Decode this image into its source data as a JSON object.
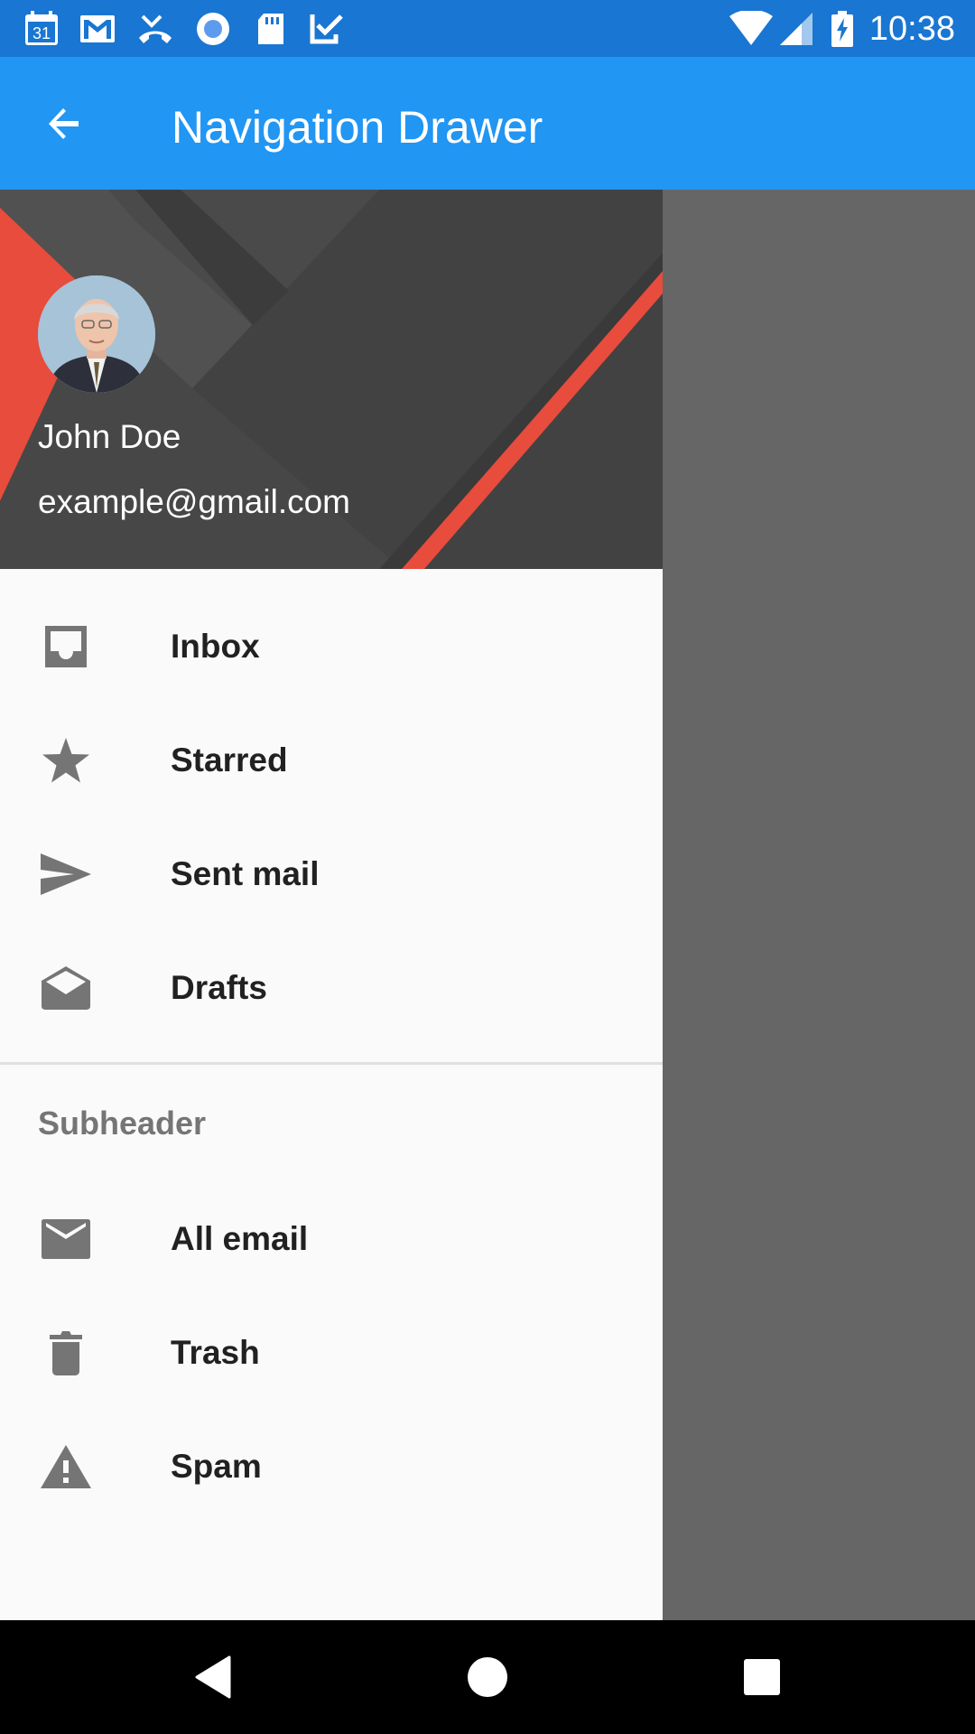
{
  "status_bar": {
    "time": "10:38",
    "calendar_day": "31",
    "icons": [
      "calendar-icon",
      "gmail-icon",
      "missed-call-icon",
      "record-icon",
      "sd-card-icon",
      "check-icon",
      "wifi-icon",
      "signal-icon",
      "battery-charging-icon"
    ],
    "color": "#1976d2"
  },
  "app_bar": {
    "title": "Navigation Drawer",
    "back_icon": "arrow-back-icon",
    "color": "#2196f3"
  },
  "drawer": {
    "header": {
      "name": "John Doe",
      "email": "example@gmail.com",
      "accent": "#e74c3c"
    },
    "items": [
      {
        "label": "Inbox",
        "icon": "inbox-icon"
      },
      {
        "label": "Starred",
        "icon": "star-icon"
      },
      {
        "label": "Sent mail",
        "icon": "send-icon"
      },
      {
        "label": "Drafts",
        "icon": "drafts-icon"
      }
    ],
    "subheader": "Subheader",
    "sub_items": [
      {
        "label": "All email",
        "icon": "mail-icon"
      },
      {
        "label": "Trash",
        "icon": "trash-icon"
      },
      {
        "label": "Spam",
        "icon": "warning-icon"
      }
    ]
  },
  "nav_bar": {
    "buttons": [
      "back-triangle-icon",
      "home-circle-icon",
      "recents-square-icon"
    ]
  }
}
